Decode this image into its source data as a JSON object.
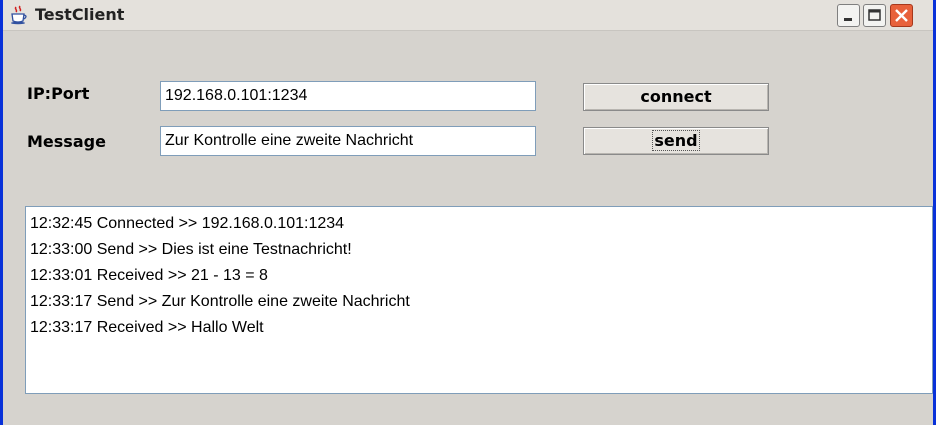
{
  "window": {
    "title": "TestClient",
    "icon": "java-cup-icon",
    "controls": [
      "minimize-icon",
      "maximize-icon",
      "close-icon"
    ]
  },
  "form": {
    "ip_label": "IP:Port",
    "ip_value": "192.168.0.101:1234",
    "message_label": "Message",
    "message_value": "Zur Kontrolle eine zweite Nachricht",
    "connect_label": "connect",
    "send_label": "send"
  },
  "log": [
    "12:32:45 Connected >> 192.168.0.101:1234",
    "12:33:00 Send >> Dies ist eine Testnachricht!",
    "12:33:01 Received >> 21 - 13 = 8",
    "12:33:17 Send >> Zur Kontrolle eine zweite Nachricht",
    "12:33:17 Received >> Hallo Welt"
  ],
  "colors": {
    "window_bg": "#d6d3ce",
    "frame_border": "#0831d9",
    "close_button": "#e8613b",
    "field_border": "#7f9db9"
  }
}
